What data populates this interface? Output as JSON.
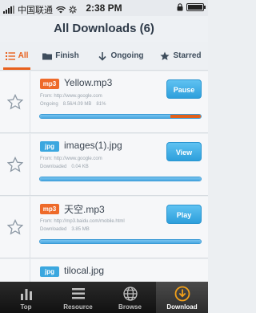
{
  "status_bar": {
    "carrier": "中国联通",
    "time": "2:38 PM"
  },
  "nav": {
    "title": "All Downloads (6)"
  },
  "tabs": [
    {
      "label": "All",
      "icon": "list-icon",
      "active": true
    },
    {
      "label": "Finish",
      "icon": "folder-icon",
      "active": false
    },
    {
      "label": "Ongoing",
      "icon": "arrow-down-icon",
      "active": false
    },
    {
      "label": "Starred",
      "icon": "star-icon",
      "active": false
    }
  ],
  "downloads": [
    {
      "type": "mp3",
      "name": "Yellow.mp3",
      "url_label": "From:",
      "url": "http://www.google.com",
      "state": "Ongoing",
      "size": "8.56/4.09 MB",
      "percent_text": "81%",
      "progress": 0.81,
      "action": "Pause"
    },
    {
      "type": "jpg",
      "name": "images(1).jpg",
      "url_label": "From:",
      "url": "http://www.google.com",
      "state": "Downloaded",
      "size": "0.04 KB",
      "percent_text": "",
      "progress": 1.0,
      "action": "View"
    },
    {
      "type": "mp3",
      "name": "天空.mp3",
      "url_label": "From:",
      "url": "http://mp3.baidu.com/mobile.html",
      "state": "Downloaded",
      "size": "3.85 MB",
      "percent_text": "",
      "progress": 1.0,
      "action": "Play"
    },
    {
      "type": "jpg",
      "name": "tilocal.jpg",
      "url_label": "",
      "url": "",
      "state": "",
      "size": "",
      "percent_text": "",
      "progress": 1.0,
      "action": ""
    }
  ],
  "tabbar": [
    {
      "label": "Top",
      "icon": "bar-chart-icon",
      "active": false
    },
    {
      "label": "Resource",
      "icon": "menu-icon",
      "active": false
    },
    {
      "label": "Browse",
      "icon": "globe-icon",
      "active": false
    },
    {
      "label": "Download",
      "icon": "download-icon",
      "active": true
    }
  ],
  "colors": {
    "accent_orange": "#e8601c",
    "button_blue": "#3aa6e3",
    "mp3_badge": "#ee6a2a",
    "jpg_badge": "#3ba7df"
  }
}
